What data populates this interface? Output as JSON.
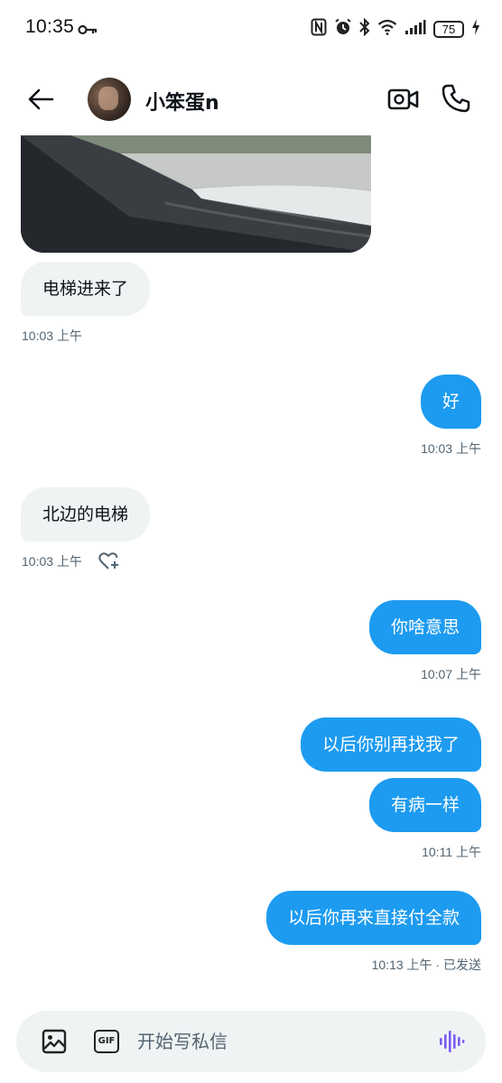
{
  "status_bar": {
    "time": "10:35",
    "battery": "75"
  },
  "header": {
    "contact_name": "小笨蛋n"
  },
  "messages": [
    {
      "direction": "in",
      "text": "电梯进来了",
      "meta": "10:03 上午"
    },
    {
      "direction": "out",
      "text": "好",
      "meta": "10:03 上午"
    },
    {
      "direction": "in",
      "text": "北边的电梯",
      "meta": "10:03 上午"
    },
    {
      "direction": "out",
      "text": "你啥意思",
      "meta": "10:07 上午"
    },
    {
      "direction": "out",
      "text": "以后你别再找我了",
      "meta": ""
    },
    {
      "direction": "out",
      "text": "有病一样",
      "meta": "10:11 上午"
    },
    {
      "direction": "out",
      "text": "以后你再来直接付全款",
      "meta": "10:13 上午 · 已发送"
    }
  ],
  "composer": {
    "placeholder": "开始写私信",
    "gif_label": "GIF"
  },
  "colors": {
    "outgoing_bubble": "#1d9bf0",
    "incoming_bubble": "#eff3f4",
    "voice_accent": "#7b5cf0"
  },
  "icons": [
    "back-arrow-icon",
    "video-call-icon",
    "phone-icon",
    "like-add-icon",
    "image-icon",
    "gif-icon",
    "voice-message-icon",
    "key-icon",
    "nfc-icon",
    "alarm-icon",
    "bluetooth-icon",
    "wifi-icon",
    "signal-icon",
    "charging-icon"
  ]
}
